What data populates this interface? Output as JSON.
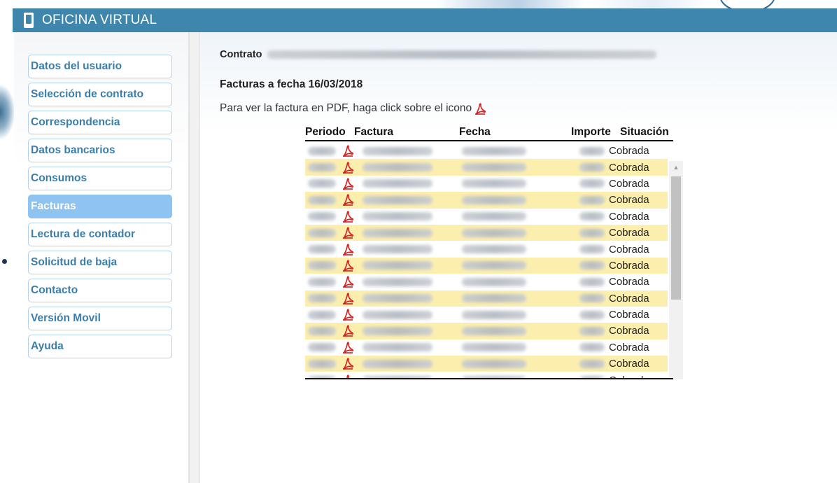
{
  "header": {
    "title": "OFICINA VIRTUAL",
    "icon": "mobile-phone-icon"
  },
  "sidebar": {
    "items": [
      {
        "label": "Datos del usuario",
        "active": false
      },
      {
        "label": "Selección de contrato",
        "active": false
      },
      {
        "label": "Correspondencia",
        "active": false
      },
      {
        "label": "Datos bancarios",
        "active": false
      },
      {
        "label": "Consumos",
        "active": false
      },
      {
        "label": "Facturas",
        "active": true
      },
      {
        "label": "Lectura de contador",
        "active": false
      },
      {
        "label": "Solicitud de baja",
        "active": false
      },
      {
        "label": "Contacto",
        "active": false
      },
      {
        "label": "Versión Movil",
        "active": false
      },
      {
        "label": "Ayuda",
        "active": false
      }
    ]
  },
  "main": {
    "contract_label": "Contrato",
    "facturas_heading": "Facturas a fecha 16/03/2018",
    "pdf_note": "Para ver la factura en PDF, haga click sobre el icono",
    "pdf_icon": "pdf-icon",
    "table": {
      "columns": [
        "Periodo",
        "Factura",
        "Fecha",
        "Importe",
        "Situación"
      ],
      "rows": [
        {
          "situacion": "Cobrada"
        },
        {
          "situacion": "Cobrada"
        },
        {
          "situacion": "Cobrada"
        },
        {
          "situacion": "Cobrada"
        },
        {
          "situacion": "Cobrada"
        },
        {
          "situacion": "Cobrada"
        },
        {
          "situacion": "Cobrada"
        },
        {
          "situacion": "Cobrada"
        },
        {
          "situacion": "Cobrada"
        },
        {
          "situacion": "Cobrada"
        },
        {
          "situacion": "Cobrada"
        },
        {
          "situacion": "Cobrada"
        },
        {
          "situacion": "Cobrada"
        },
        {
          "situacion": "Cobrada"
        },
        {
          "situacion": "Cobrada"
        }
      ]
    }
  },
  "colors": {
    "header_bg": "#3f86ad",
    "menu_text": "#3c7eaa",
    "menu_active_bg": "#8ec4ef",
    "row_alt_bg": "#fcefae",
    "pdf_red": "#d42020"
  }
}
